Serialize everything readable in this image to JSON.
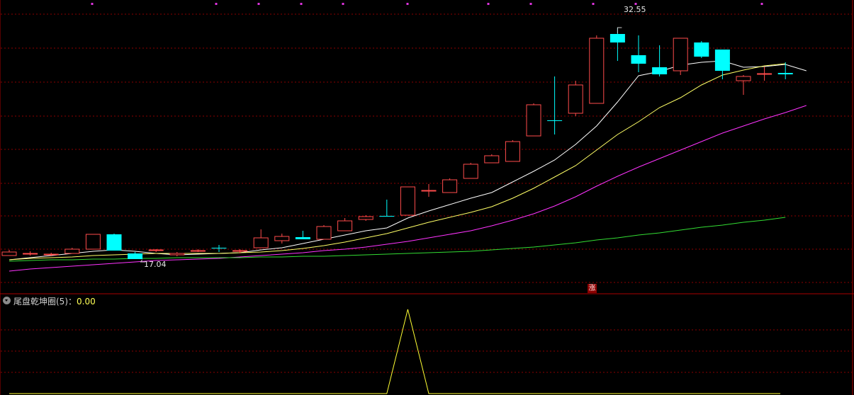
{
  "chart_data": [
    {
      "type": "candlestick",
      "ylim": [
        14.5,
        34.5
      ],
      "grid": true,
      "annotations": {
        "max_price": "32.55",
        "min_price": "17.04"
      },
      "candles": [
        {
          "o": 16.7,
          "h": 16.85,
          "l": 16.45,
          "c": 16.45,
          "bull": true
        },
        {
          "o": 16.6,
          "h": 16.75,
          "l": 16.45,
          "c": 16.6,
          "bull": true
        },
        {
          "o": 16.5,
          "h": 16.65,
          "l": 16.4,
          "c": 16.55,
          "bull": true
        },
        {
          "o": 16.6,
          "h": 17.0,
          "l": 16.6,
          "c": 16.9,
          "bull": true
        },
        {
          "o": 16.9,
          "h": 17.95,
          "l": 16.9,
          "c": 17.95,
          "bull": true
        },
        {
          "o": 17.95,
          "h": 18.0,
          "l": 16.8,
          "c": 16.8,
          "bull": false
        },
        {
          "o": 16.6,
          "h": 16.7,
          "l": 16.2,
          "c": 16.2,
          "bull": false
        },
        {
          "o": 16.8,
          "h": 16.9,
          "l": 16.7,
          "c": 16.85,
          "bull": true
        },
        {
          "o": 16.6,
          "h": 16.7,
          "l": 16.4,
          "c": 16.5,
          "bull": true
        },
        {
          "o": 16.8,
          "h": 16.9,
          "l": 16.7,
          "c": 16.8,
          "bull": true
        },
        {
          "o": 17.0,
          "h": 17.2,
          "l": 16.7,
          "c": 17.0,
          "bull": false
        },
        {
          "o": 16.8,
          "h": 16.9,
          "l": 16.6,
          "c": 16.8,
          "bull": true
        },
        {
          "o": 17.0,
          "h": 18.3,
          "l": 17.0,
          "c": 17.7,
          "bull": true
        },
        {
          "o": 17.5,
          "h": 18.0,
          "l": 17.3,
          "c": 17.8,
          "bull": true
        },
        {
          "o": 17.75,
          "h": 18.2,
          "l": 17.6,
          "c": 17.6,
          "bull": false
        },
        {
          "o": 17.6,
          "h": 18.6,
          "l": 17.6,
          "c": 18.5,
          "bull": true
        },
        {
          "o": 18.2,
          "h": 19.1,
          "l": 18.2,
          "c": 18.9,
          "bull": true
        },
        {
          "o": 19.0,
          "h": 19.3,
          "l": 18.9,
          "c": 19.2,
          "bull": true
        },
        {
          "o": 19.25,
          "h": 20.4,
          "l": 19.25,
          "c": 19.25,
          "bull": false
        },
        {
          "o": 19.3,
          "h": 21.3,
          "l": 19.3,
          "c": 21.3,
          "bull": true
        },
        {
          "o": 21.05,
          "h": 21.5,
          "l": 20.6,
          "c": 21.05,
          "bull": true
        },
        {
          "o": 20.9,
          "h": 21.9,
          "l": 20.9,
          "c": 21.8,
          "bull": true
        },
        {
          "o": 21.9,
          "h": 23.0,
          "l": 21.9,
          "c": 22.9,
          "bull": true
        },
        {
          "o": 23.0,
          "h": 23.6,
          "l": 23.0,
          "c": 23.5,
          "bull": true
        },
        {
          "o": 23.1,
          "h": 24.6,
          "l": 23.1,
          "c": 24.5,
          "bull": true
        },
        {
          "o": 24.9,
          "h": 27.2,
          "l": 24.9,
          "c": 27.1,
          "bull": true
        },
        {
          "o": 26.0,
          "h": 29.1,
          "l": 25.0,
          "c": 26.0,
          "bull": false
        },
        {
          "o": 26.5,
          "h": 28.8,
          "l": 26.3,
          "c": 28.5,
          "bull": true
        },
        {
          "o": 27.2,
          "h": 32.0,
          "l": 27.2,
          "c": 31.8,
          "bull": true
        },
        {
          "o": 32.1,
          "h": 32.55,
          "l": 30.2,
          "c": 31.5,
          "bull": false
        },
        {
          "o": 30.6,
          "h": 32.0,
          "l": 29.4,
          "c": 30.0,
          "bull": false
        },
        {
          "o": 29.75,
          "h": 31.3,
          "l": 29.1,
          "c": 29.25,
          "bull": false
        },
        {
          "o": 29.5,
          "h": 31.8,
          "l": 29.2,
          "c": 31.8,
          "bull": true
        },
        {
          "o": 31.5,
          "h": 31.6,
          "l": 30.4,
          "c": 30.5,
          "bull": false
        },
        {
          "o": 31.0,
          "h": 31.0,
          "l": 28.9,
          "c": 29.5,
          "bull": false
        },
        {
          "o": 28.8,
          "h": 29.2,
          "l": 27.8,
          "c": 29.1,
          "bull": true
        },
        {
          "o": 29.3,
          "h": 29.8,
          "l": 28.8,
          "c": 29.3,
          "bull": true
        },
        {
          "o": 29.25,
          "h": 30.1,
          "l": 28.9,
          "c": 29.35,
          "bull": false
        }
      ],
      "series": [
        {
          "color": "#ffffff",
          "values": [
            16.15,
            16.3,
            16.45,
            16.6,
            16.75,
            16.85,
            16.75,
            16.6,
            16.5,
            16.55,
            16.6,
            16.65,
            16.85,
            17.0,
            17.3,
            17.6,
            17.9,
            18.2,
            18.4,
            19.1,
            19.6,
            20.05,
            20.5,
            20.9,
            21.65,
            22.4,
            23.2,
            24.3,
            25.6,
            27.3,
            29.15,
            29.45,
            29.9,
            30.1,
            30.2,
            29.75,
            29.8,
            29.95,
            29.5
          ]
        },
        {
          "color": "#ffff66",
          "values": [
            16.15,
            16.25,
            16.3,
            16.35,
            16.45,
            16.5,
            16.55,
            16.6,
            16.6,
            16.6,
            16.6,
            16.65,
            16.7,
            16.8,
            16.95,
            17.15,
            17.4,
            17.7,
            18.0,
            18.4,
            18.8,
            19.15,
            19.5,
            19.9,
            20.5,
            21.2,
            22.0,
            22.8,
            23.9,
            25.0,
            25.9,
            26.9,
            27.6,
            28.5,
            29.2,
            29.55,
            29.85,
            30.0
          ]
        },
        {
          "color": "#ff33ff",
          "values": [
            15.35,
            15.5,
            15.6,
            15.7,
            15.8,
            15.9,
            16.0,
            16.1,
            16.15,
            16.2,
            16.25,
            16.35,
            16.45,
            16.55,
            16.65,
            16.8,
            16.9,
            17.05,
            17.25,
            17.45,
            17.7,
            17.95,
            18.2,
            18.55,
            18.95,
            19.4,
            19.95,
            20.6,
            21.35,
            22.05,
            22.7,
            23.3,
            23.9,
            24.5,
            25.1,
            25.6,
            26.1,
            26.55,
            27.05
          ]
        },
        {
          "color": "#33dd33",
          "values": [
            16.05,
            16.1,
            16.15,
            16.15,
            16.2,
            16.2,
            16.25,
            16.25,
            16.3,
            16.3,
            16.3,
            16.3,
            16.35,
            16.35,
            16.4,
            16.4,
            16.45,
            16.5,
            16.55,
            16.6,
            16.65,
            16.7,
            16.75,
            16.85,
            16.95,
            17.05,
            17.2,
            17.35,
            17.55,
            17.7,
            17.9,
            18.05,
            18.25,
            18.45,
            18.6,
            18.8,
            18.95,
            19.15
          ]
        }
      ]
    },
    {
      "type": "line",
      "title": "尾盘乾坤圈(5)",
      "current_value": "0.00",
      "ylim": [
        0,
        1
      ],
      "series": [
        {
          "color": "#ffff33",
          "x_index": [
            0,
            18,
            19,
            20,
            37
          ],
          "values": [
            0,
            0,
            1,
            0,
            0
          ]
        }
      ]
    }
  ],
  "indicator": {
    "title": "尾盘乾坤圈(5)",
    "separator": "：",
    "value": "0.00"
  },
  "badge": {
    "text": "涨"
  },
  "colors": {
    "bull": "#ff4c4c",
    "bear": "#00ffff",
    "grid": "#8b0000",
    "axis": "#aa0000"
  }
}
